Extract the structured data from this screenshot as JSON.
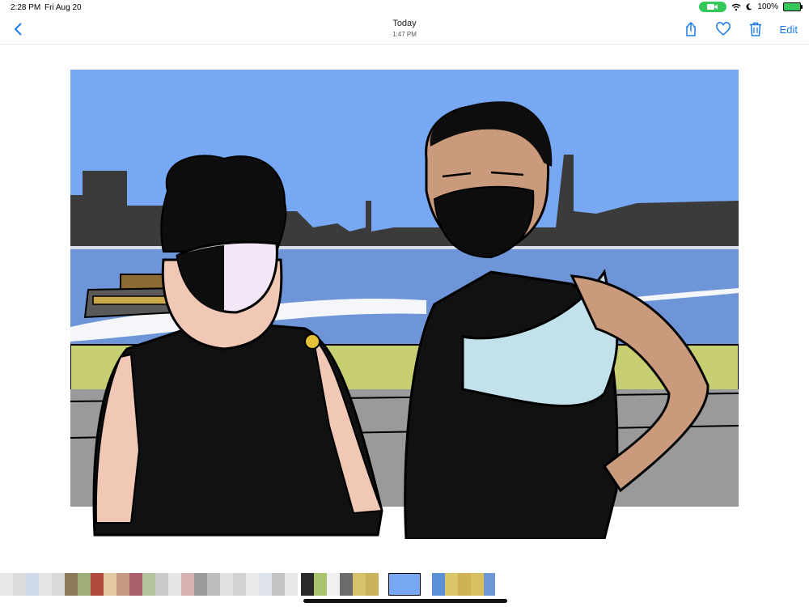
{
  "status": {
    "time": "2:28 PM",
    "date": "Fri Aug 20",
    "battery": "100%",
    "camera_icon": "video-camera-icon",
    "wifi_icon": "wifi-icon",
    "moon_icon": "moon-icon"
  },
  "nav": {
    "title": "Today",
    "subtitle": "1:47 PM",
    "edit_label": "Edit",
    "back_icon": "chevron-left-icon",
    "share_icon": "share-icon",
    "favorite_icon": "heart-icon",
    "delete_icon": "trash-icon"
  },
  "colors": {
    "accent": "#1a7cf0",
    "sky": "#78a8f4",
    "skyline": "#3b3b3b",
    "water": "#6d95d8",
    "mask": "#f3e6f6",
    "tank": "#c3e1ea"
  },
  "thumbnails": {
    "count_visible": "many",
    "selected_index": "current"
  }
}
